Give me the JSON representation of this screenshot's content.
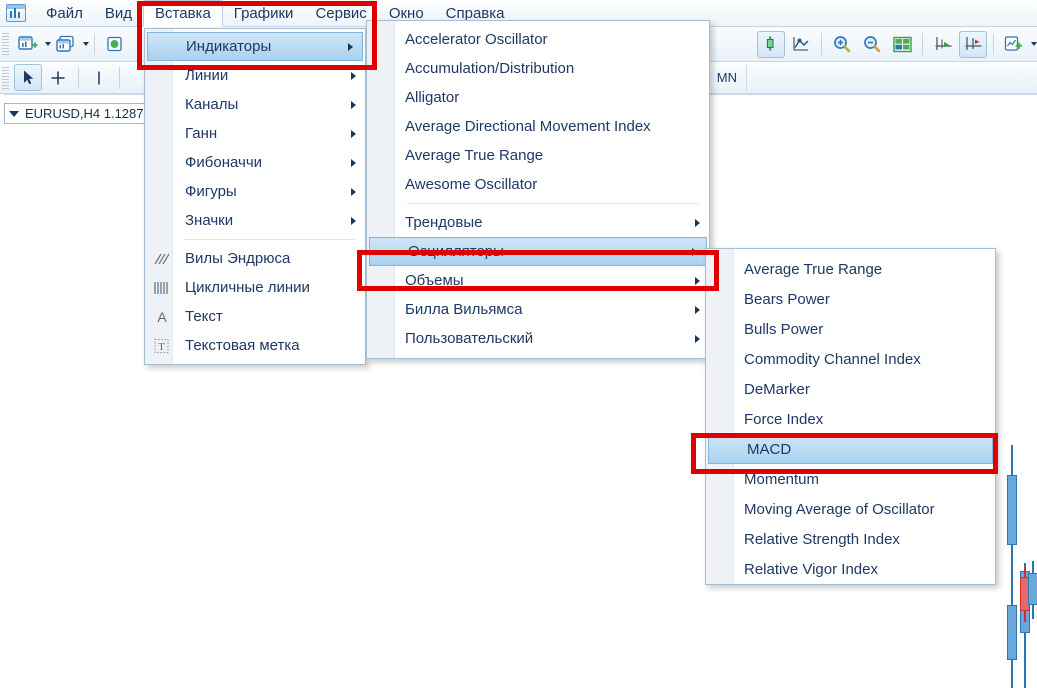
{
  "app": {
    "icon": "chart-window-icon",
    "menubar": [
      {
        "label": "Файл",
        "open": false
      },
      {
        "label": "Вид",
        "open": false
      },
      {
        "label": "Вставка",
        "open": true
      },
      {
        "label": "Графики",
        "open": false
      },
      {
        "label": "Сервис",
        "open": false
      },
      {
        "label": "Окно",
        "open": false
      },
      {
        "label": "Справка",
        "open": false
      }
    ]
  },
  "toolbar_top": [
    {
      "icon": "new-chart-icon",
      "dropdown": true,
      "active": false
    },
    {
      "icon": "profiles-icon",
      "dropdown": true,
      "active": false
    },
    {
      "icon": "new-order-icon",
      "dropdown": false,
      "active": false
    },
    {
      "icon": "candlestick-chart-icon",
      "dropdown": false,
      "active": true
    },
    {
      "icon": "line-chart-icon",
      "dropdown": false,
      "active": false
    },
    {
      "icon": "zoom-in-icon",
      "dropdown": false,
      "active": false
    },
    {
      "icon": "zoom-out-icon",
      "dropdown": false,
      "active": false
    },
    {
      "icon": "tile-windows-icon",
      "dropdown": false,
      "active": false
    },
    {
      "icon": "auto-scroll-icon",
      "dropdown": false,
      "active": false
    },
    {
      "icon": "chart-shift-icon",
      "dropdown": false,
      "active": true
    },
    {
      "icon": "indicators-add-icon",
      "dropdown": true,
      "active": false
    }
  ],
  "toolbar_tools": [
    {
      "icon": "cursor-arrow-icon",
      "active": true
    },
    {
      "icon": "crosshair-icon",
      "active": false
    },
    {
      "icon": "vertical-line-icon",
      "active": false
    }
  ],
  "timeframe_tab": {
    "label": "MN"
  },
  "chart": {
    "symbol_label": "EURUSD,H4  1.1287",
    "dropdown_icon": "triangle-down-icon"
  },
  "menus": {
    "insert": {
      "name": "Вставка",
      "items": [
        {
          "label": "Индикаторы",
          "submenu": true,
          "selected": true,
          "icon": ""
        },
        {
          "label": "Линии",
          "submenu": true,
          "selected": false,
          "icon": ""
        },
        {
          "label": "Каналы",
          "submenu": true,
          "selected": false,
          "icon": ""
        },
        {
          "label": "Ганн",
          "submenu": true,
          "selected": false,
          "icon": ""
        },
        {
          "label": "Фибоначчи",
          "submenu": true,
          "selected": false,
          "icon": ""
        },
        {
          "label": "Фигуры",
          "submenu": true,
          "selected": false,
          "icon": ""
        },
        {
          "label": "Значки",
          "submenu": true,
          "selected": false,
          "icon": ""
        },
        {
          "separator": true
        },
        {
          "label": "Вилы Эндрюса",
          "submenu": false,
          "selected": false,
          "icon": "andrews-pitchfork-icon"
        },
        {
          "label": "Цикличные линии",
          "submenu": false,
          "selected": false,
          "icon": "cyclic-lines-icon"
        },
        {
          "label": "Текст",
          "submenu": false,
          "selected": false,
          "icon": "text-icon"
        },
        {
          "label": "Текстовая метка",
          "submenu": false,
          "selected": false,
          "icon": "text-label-icon"
        }
      ]
    },
    "indicators": {
      "name": "Индикаторы",
      "items": [
        {
          "label": "Accelerator Oscillator",
          "submenu": false,
          "selected": false
        },
        {
          "label": "Accumulation/Distribution",
          "submenu": false,
          "selected": false
        },
        {
          "label": "Alligator",
          "submenu": false,
          "selected": false
        },
        {
          "label": "Average Directional Movement Index",
          "submenu": false,
          "selected": false
        },
        {
          "label": "Average True Range",
          "submenu": false,
          "selected": false
        },
        {
          "label": "Awesome Oscillator",
          "submenu": false,
          "selected": false
        },
        {
          "separator": true
        },
        {
          "label": "Трендовые",
          "submenu": true,
          "selected": false
        },
        {
          "label": "Осцилляторы",
          "submenu": true,
          "selected": true
        },
        {
          "label": "Объемы",
          "submenu": true,
          "selected": false
        },
        {
          "label": "Билла Вильямса",
          "submenu": true,
          "selected": false
        },
        {
          "label": "Пользовательский",
          "submenu": true,
          "selected": false
        }
      ]
    },
    "oscillators": {
      "name": "Осцилляторы",
      "items": [
        {
          "label": "Average True Range",
          "selected": false
        },
        {
          "label": "Bears Power",
          "selected": false
        },
        {
          "label": "Bulls Power",
          "selected": false
        },
        {
          "label": "Commodity Channel Index",
          "selected": false
        },
        {
          "label": "DeMarker",
          "selected": false
        },
        {
          "label": "Force Index",
          "selected": false
        },
        {
          "label": "MACD",
          "selected": true
        },
        {
          "label": "Momentum",
          "selected": false
        },
        {
          "label": "Moving Average of Oscillator",
          "selected": false
        },
        {
          "label": "Relative Strength Index",
          "selected": false
        },
        {
          "label": "Relative Vigor Index",
          "selected": false
        }
      ]
    }
  },
  "annotations": {
    "highlight_color": "#e00000",
    "boxes": [
      {
        "target": "Индикаторы"
      },
      {
        "target": "Осцилляторы"
      },
      {
        "target": "MACD"
      }
    ]
  },
  "colors": {
    "menu_text": "#1f3864",
    "selection_fill": "#a9d2ef",
    "selection_border": "#7fb4dd",
    "candle_bull": "#2e75b6",
    "candle_bear": "#d42a2a"
  }
}
